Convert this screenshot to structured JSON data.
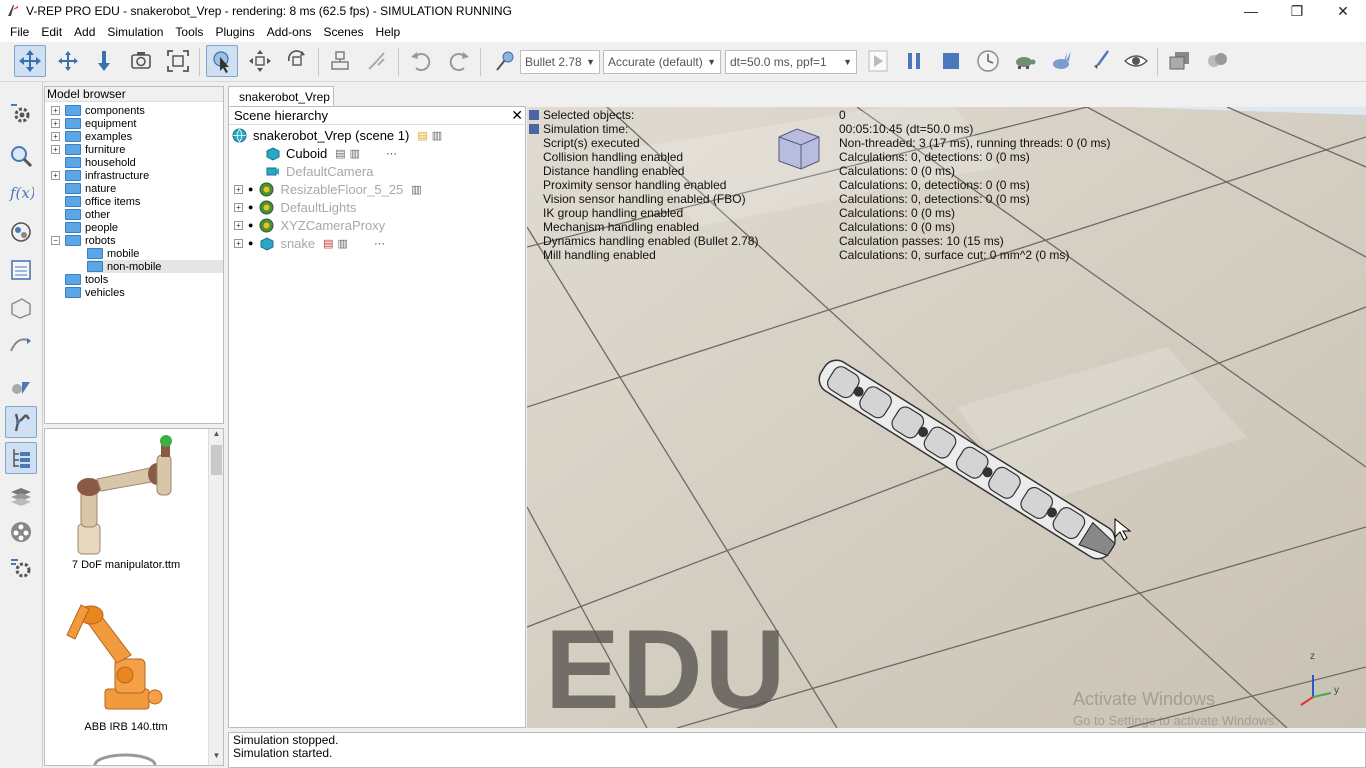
{
  "window": {
    "title": "V-REP PRO EDU - snakerobot_Vrep - rendering: 8 ms (62.5 fps) - SIMULATION RUNNING"
  },
  "menu": [
    "File",
    "Edit",
    "Add",
    "Simulation",
    "Tools",
    "Plugins",
    "Add-ons",
    "Scenes",
    "Help"
  ],
  "toolbar": {
    "engine": "Bullet 2.78",
    "accuracy": "Accurate (default)",
    "timestep": "dt=50.0 ms, ppf=1"
  },
  "model_browser": {
    "title": "Model browser",
    "items": [
      {
        "label": "components",
        "expandable": true
      },
      {
        "label": "equipment",
        "expandable": true
      },
      {
        "label": "examples",
        "expandable": true
      },
      {
        "label": "furniture",
        "expandable": true
      },
      {
        "label": "household",
        "expandable": false
      },
      {
        "label": "infrastructure",
        "expandable": true
      },
      {
        "label": "nature",
        "expandable": false
      },
      {
        "label": "office items",
        "expandable": false
      },
      {
        "label": "other",
        "expandable": false
      },
      {
        "label": "people",
        "expandable": false
      },
      {
        "label": "robots",
        "expandable": true
      },
      {
        "label": "mobile",
        "expandable": false
      },
      {
        "label": "non-mobile",
        "expandable": false
      },
      {
        "label": "tools",
        "expandable": false
      },
      {
        "label": "vehicles",
        "expandable": false
      }
    ],
    "thumbnails": [
      "7 DoF manipulator.ttm",
      "ABB IRB 140.ttm"
    ]
  },
  "scene": {
    "tab": "snakerobot_Vrep",
    "hierarchy_title": "Scene hierarchy",
    "root": "snakerobot_Vrep (scene 1)",
    "objects": [
      "Cuboid",
      "DefaultCamera",
      "ResizableFloor_5_25",
      "DefaultLights",
      "XYZCameraProxy",
      "snake"
    ]
  },
  "info_overlay": {
    "labels": [
      "Selected objects:",
      "Simulation time:",
      "Script(s) executed",
      "Collision handling enabled",
      "Distance handling enabled",
      "Proximity sensor handling enabled",
      "Vision sensor handling enabled (FBO)",
      "IK group handling enabled",
      "Mechanism handling enabled",
      "Dynamics handling enabled (Bullet 2.78)",
      "Mill handling enabled"
    ],
    "values": [
      "0",
      "00:05:10.45 (dt=50.0 ms)",
      "Non-threaded: 3 (17 ms), running threads: 0 (0 ms)",
      "Calculations: 0, detections: 0 (0 ms)",
      "Calculations: 0 (0 ms)",
      "Calculations: 0, detections: 0 (0 ms)",
      "Calculations: 0, detections: 0 (0 ms)",
      "Calculations: 0 (0 ms)",
      "Calculations: 0 (0 ms)",
      "Calculation passes: 10 (15 ms)",
      "Calculations: 0, surface cut: 0 mm^2 (0 ms)"
    ]
  },
  "viewport": {
    "watermark": "EDU",
    "activate_title": "Activate Windows",
    "activate_sub": "Go to Settings to activate Windows.",
    "axes": {
      "z": "z",
      "y": "y"
    }
  },
  "status": [
    "Simulation stopped.",
    "Simulation started."
  ],
  "colors": {
    "accent": "#7fa5cf",
    "folder": "#5aa6e6",
    "cuboid": "#2aa7c7"
  }
}
